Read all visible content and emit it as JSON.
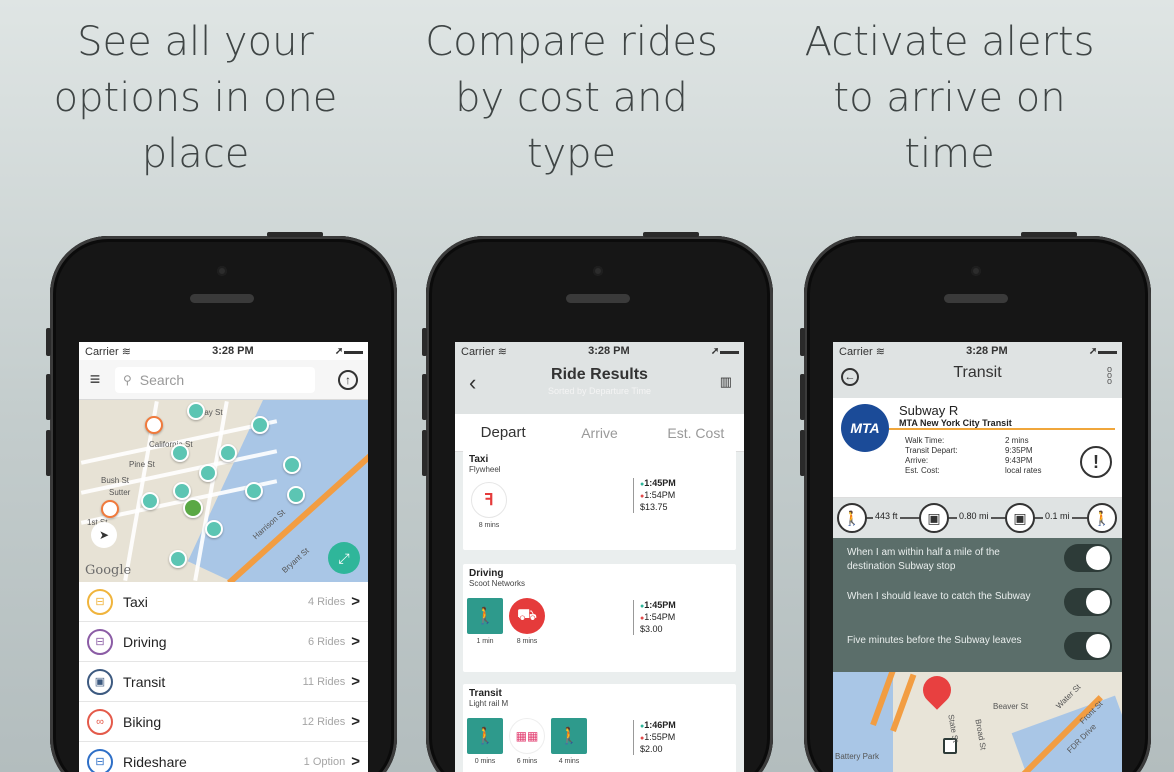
{
  "captions": [
    "See all your\noptions in one\nplace",
    "Compare rides\nby cost and\ntype",
    "Activate alerts\nto arrive on\ntime"
  ],
  "status_bar": {
    "carrier": "Carrier",
    "time": "3:28 PM"
  },
  "screen1": {
    "search_placeholder": "Search",
    "map_labels": [
      "California St",
      "Pine St",
      "Bush St",
      "Sutter",
      "Harrison St",
      "Bryant St",
      "Bay St",
      "1st St"
    ],
    "google_label": "Google",
    "modes": [
      {
        "name": "Taxi",
        "count": "4 Rides",
        "color": "#f0b43c",
        "icon": "taxi-icon",
        "glyph": "⊟"
      },
      {
        "name": "Driving",
        "count": "6 Rides",
        "color": "#8b5ca5",
        "icon": "car-icon",
        "glyph": "⊟"
      },
      {
        "name": "Transit",
        "count": "11 Rides",
        "color": "#3d5a80",
        "icon": "bus-icon",
        "glyph": "▣"
      },
      {
        "name": "Biking",
        "count": "12 Rides",
        "color": "#e45a4a",
        "icon": "bike-icon",
        "glyph": "⚲"
      },
      {
        "name": "Rideshare",
        "count": "1 Option",
        "color": "#2e6fc7",
        "icon": "rideshare-icon",
        "glyph": "⊟"
      }
    ]
  },
  "screen2": {
    "title": "Ride Results",
    "subtitle": "Sorted by Departure Time",
    "tabs": [
      "Depart",
      "Arrive",
      "Est. Cost"
    ],
    "cards": [
      {
        "type": "Taxi",
        "provider": "Flywheel",
        "depart": "1:45PM",
        "arrive": "1:54PM",
        "cost": "$13.75",
        "walk": "8 mins"
      },
      {
        "type": "Driving",
        "provider": "Scoot Networks",
        "depart": "1:45PM",
        "arrive": "1:54PM",
        "cost": "$3.00",
        "walk": "1 min",
        "ride": "8 mins",
        "brand": "scoot"
      },
      {
        "type": "Transit",
        "provider": "Light rail M",
        "depart": "1:46PM",
        "arrive": "1:55PM",
        "cost": "$2.00",
        "walk": "0 mins",
        "ride": "6 mins",
        "walk2": "4 mins"
      }
    ],
    "flywheel_label": "Flywheel"
  },
  "screen3": {
    "title": "Transit",
    "line_name": "Subway R",
    "agency": "MTA New York City Transit",
    "logo_text": "MTA",
    "details": [
      {
        "k": "Walk Time:",
        "v": "2 mins"
      },
      {
        "k": "Transit Depart:",
        "v": "9:35PM"
      },
      {
        "k": "Arrive:",
        "v": "9:43PM"
      },
      {
        "k": "Est. Cost:",
        "v": "local rates"
      }
    ],
    "steps": [
      "443 ft",
      "0.80 mi",
      "0.1 mi"
    ],
    "alerts": [
      {
        "text": "When I am within half a mile of the destination Subway stop",
        "on": true
      },
      {
        "text": "When I should leave to catch the Subway",
        "on": true
      },
      {
        "text": "Five minutes before the Subway leaves",
        "on": true
      }
    ],
    "map_labels": [
      "Beaver St",
      "Water St",
      "Front St",
      "FDR Drive",
      "State St",
      "Broad St",
      "Battery Park"
    ]
  }
}
